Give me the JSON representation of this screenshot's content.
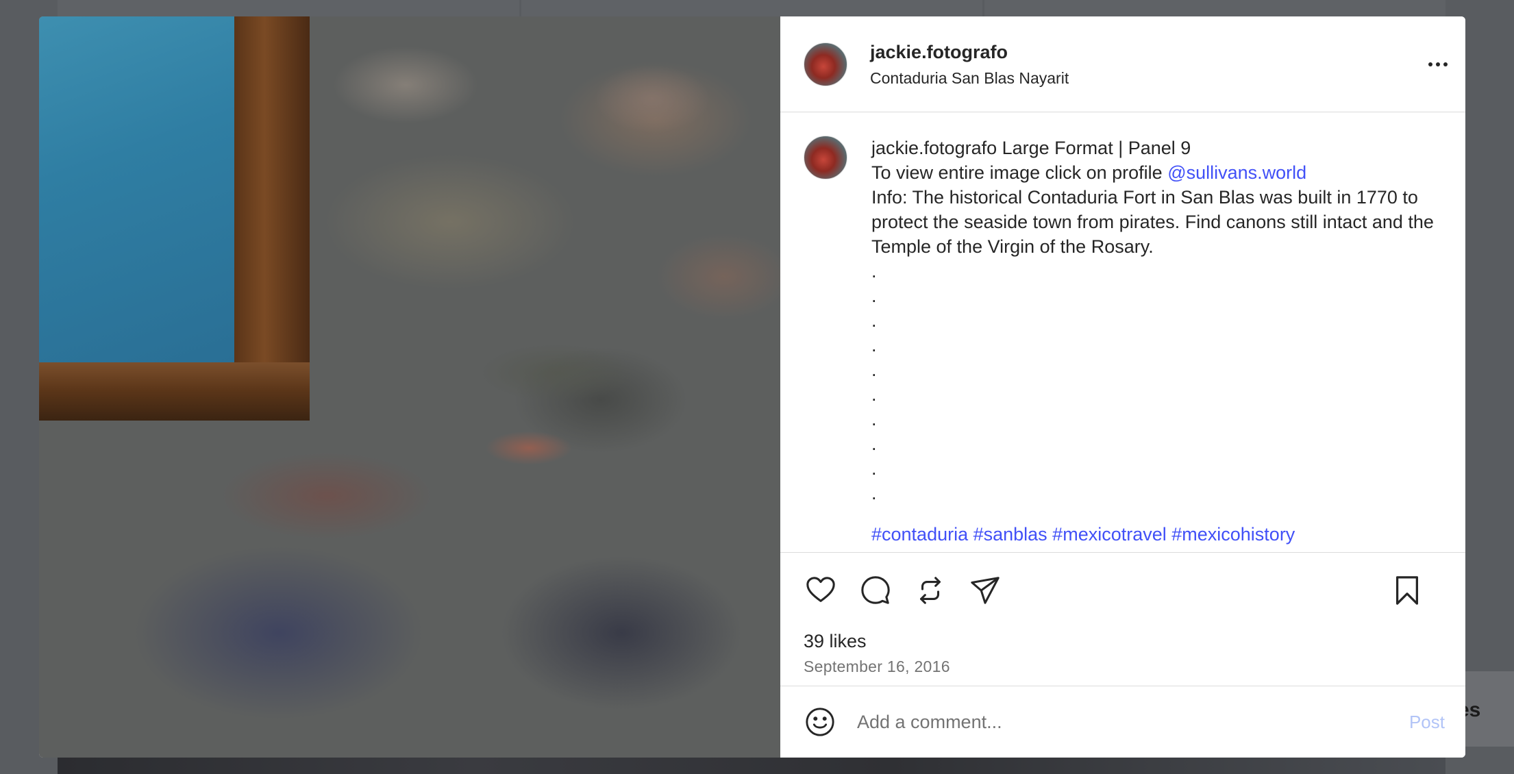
{
  "post": {
    "username": "jackie.fotografo",
    "location": "Contaduria San Blas Nayarit",
    "caption": {
      "username": "jackie.fotografo",
      "line1": "Large Format | Panel 9",
      "line2_prefix": "To view entire image click on profile",
      "mention": "@sullivans.world",
      "info": "Info: The historical Contaduria Fort in San Blas was built in 1770 to protect the seaside town from pirates. Find canons still intact and the Temple of the Virgin of the Rosary.",
      "dots": [
        ".",
        ".",
        ".",
        ".",
        ".",
        ".",
        ".",
        ".",
        ".",
        "."
      ],
      "hashtags": "#contaduria #sanblas #mexicotravel #mexicohistory"
    },
    "likes": "39 likes",
    "date": "September 16, 2016"
  },
  "comment_bar": {
    "placeholder": "Add a comment...",
    "post_label": "Post"
  },
  "icons": {
    "more": "more-options-icon",
    "like": "heart-icon",
    "comment": "comment-icon",
    "repost": "repost-icon",
    "share": "send-icon",
    "save": "bookmark-icon",
    "emoji": "emoji-icon"
  },
  "colors": {
    "link": "#4150f7",
    "post_disabled": "#b2c4f7",
    "secondary_text": "#737373"
  },
  "background": {
    "partial_text": "es"
  }
}
